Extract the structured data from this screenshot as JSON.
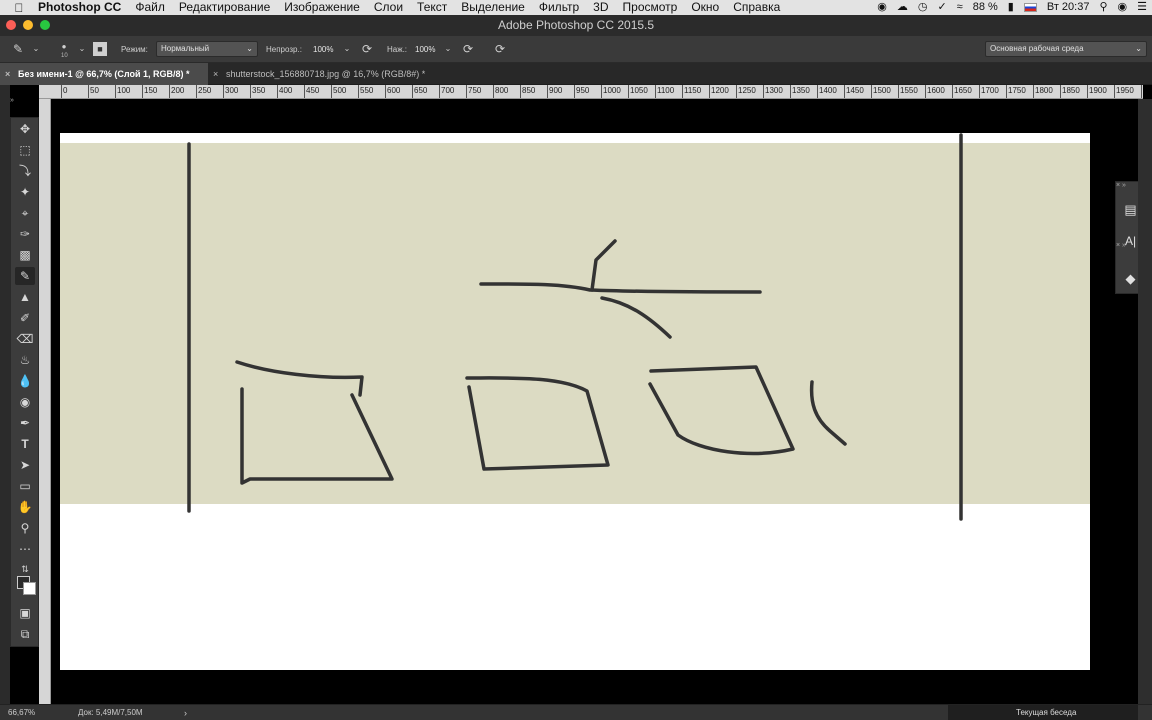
{
  "menubar": {
    "app_name": "Photoshop CC",
    "items": [
      "Файл",
      "Редактирование",
      "Изображение",
      "Слои",
      "Текст",
      "Выделение",
      "Фильтр",
      "3D",
      "Просмотр",
      "Окно",
      "Справка"
    ],
    "battery": "88 %",
    "clock": "Вт 20:37"
  },
  "window": {
    "title": "Adobe Photoshop CC 2015.5"
  },
  "options": {
    "brush_size": "10",
    "mode_label": "Режим:",
    "mode_value": "Нормальный",
    "opacity_label": "Непрозр.:",
    "opacity_value": "100%",
    "pressure_label": "Наж.:",
    "pressure_value": "100%",
    "workspace": "Основная рабочая среда"
  },
  "tabs": [
    {
      "label": "Без имени-1 @ 66,7% (Слой 1, RGB/8) *",
      "active": true
    },
    {
      "label": "shutterstock_156880718.jpg @ 16,7% (RGB/8#) *",
      "active": false
    }
  ],
  "ruler": {
    "ticks": [
      "0",
      "50",
      "100",
      "150",
      "200",
      "250",
      "300",
      "350",
      "400",
      "450",
      "500",
      "550",
      "600",
      "650",
      "700",
      "750",
      "800",
      "850",
      "900",
      "950",
      "1000",
      "1050",
      "1100",
      "1150",
      "1200",
      "1250",
      "1300",
      "1350",
      "1400",
      "1450",
      "1500",
      "1550",
      "1600",
      "1650",
      "1700",
      "1750",
      "1800",
      "1850",
      "1900",
      "1950",
      "20"
    ]
  },
  "tools": [
    "move-tool-icon",
    "marquee-tool-icon",
    "lasso-tool-icon",
    "magic-wand-tool-icon",
    "crop-tool-icon",
    "eyedropper-tool-icon",
    "patch-tool-icon",
    "brush-tool-icon",
    "clone-stamp-tool-icon",
    "history-brush-tool-icon",
    "eraser-tool-icon",
    "paint-bucket-tool-icon",
    "blur-tool-icon",
    "dodge-tool-icon",
    "pen-tool-icon",
    "type-tool-icon",
    "path-selection-tool-icon",
    "rectangle-tool-icon",
    "hand-tool-icon",
    "zoom-tool-icon",
    "more-tools-icon"
  ],
  "document": {
    "background": "#ffffff",
    "band_color": "#dcdbc3",
    "stroke_color": "#333333"
  },
  "status": {
    "zoom": "66,67%",
    "doc_size": "Док: 5,49M/7,50M",
    "conversation": "Текущая беседа"
  }
}
